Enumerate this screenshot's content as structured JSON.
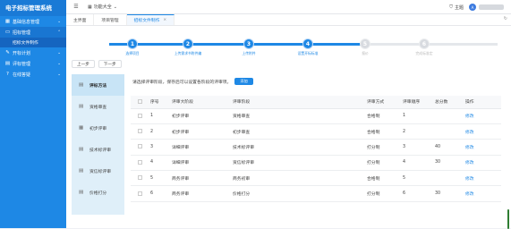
{
  "app": {
    "title": "电子招标管理系统"
  },
  "sidebar": {
    "items": [
      {
        "label": "基础信息管理",
        "icon": "grid-icon"
      },
      {
        "label": "招标管理",
        "icon": "folder-icon"
      },
      {
        "label": "开标计划",
        "icon": "pencil-icon"
      },
      {
        "label": "评标管理",
        "icon": "chart-icon"
      },
      {
        "label": "在线答疑",
        "icon": "question-icon"
      }
    ],
    "sub_items": [
      {
        "label": "招标文件制作"
      }
    ]
  },
  "topbar": {
    "function_label": "功能大全",
    "theme_label": "主题",
    "avatar_text": "A"
  },
  "tabs": [
    {
      "label": "主界面"
    },
    {
      "label": "项目管理"
    },
    {
      "label": "招标文件制作",
      "active": true
    }
  ],
  "steps": [
    {
      "num": "1",
      "label": "选择项目",
      "done": true
    },
    {
      "num": "2",
      "label": "上传需求书附件编",
      "done": true
    },
    {
      "num": "3",
      "label": "上传附件",
      "done": true
    },
    {
      "num": "4",
      "label": "设置开标标准",
      "done": true
    },
    {
      "num": "5",
      "label": "报价",
      "done": false
    },
    {
      "num": "6",
      "label": "完成标准定",
      "done": false
    }
  ],
  "buttons": {
    "prev": "上一步",
    "next": "下一步",
    "add": "添加"
  },
  "left_tabs": [
    {
      "label": "评标方法",
      "icon": "doc-icon",
      "active": true
    },
    {
      "label": "资格审查",
      "icon": "doc-icon"
    },
    {
      "label": "初步评审",
      "icon": "grid-icon"
    },
    {
      "label": "技术标评审",
      "icon": "doc-icon"
    },
    {
      "label": "资信标评审",
      "icon": "doc-icon"
    },
    {
      "label": "价格打分",
      "icon": "doc-icon"
    }
  ],
  "hint": "请选择评审阶段，保存后可以设置各阶段的评审项。",
  "table": {
    "headers": [
      "",
      "序号",
      "评审大阶段",
      "评审阶段",
      "评审方式",
      "评审顺序",
      "总分数",
      "操作"
    ],
    "rows": [
      [
        "1",
        "初步评审",
        "资格审查",
        "合格制",
        "1",
        "",
        "修改"
      ],
      [
        "2",
        "初步评审",
        "初步审查",
        "合格制",
        "2",
        "",
        "修改"
      ],
      [
        "3",
        "详细评审",
        "技术标评审",
        "打分制",
        "3",
        "40",
        "修改"
      ],
      [
        "4",
        "详细评审",
        "资信标评审",
        "打分制",
        "4",
        "30",
        "修改"
      ],
      [
        "5",
        "商务评审",
        "商务初审",
        "合格制",
        "5",
        "",
        "修改"
      ],
      [
        "6",
        "商务评审",
        "价格打分",
        "打分制",
        "6",
        "30",
        "修改"
      ]
    ]
  }
}
